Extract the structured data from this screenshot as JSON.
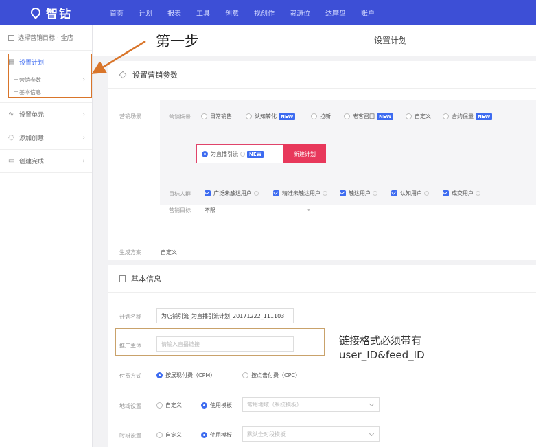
{
  "topbar": {
    "logo_text": "智钻",
    "nav": [
      "首页",
      "计划",
      "报表",
      "工具",
      "创意",
      "找创作",
      "资源位",
      "达摩盘",
      "账户"
    ]
  },
  "sidebar": {
    "target_label": "选择营销目标 · 全店",
    "items": [
      {
        "label": "设置计划",
        "active": true,
        "sub": [
          "营销参数",
          "基本信息"
        ]
      },
      {
        "label": "设置单元"
      },
      {
        "label": "添加创意"
      },
      {
        "label": "创建完成"
      }
    ]
  },
  "main": {
    "step_label": "第一步",
    "page_title": "设置计划"
  },
  "marketing": {
    "title": "设置营销参数",
    "section_label": "营销场景",
    "scene_label": "营销场景",
    "scenes": [
      {
        "label": "日常销售",
        "new": false,
        "selected": false
      },
      {
        "label": "认知转化",
        "new": true,
        "selected": false
      },
      {
        "label": "拉新",
        "new": false,
        "selected": false
      },
      {
        "label": "老客召回",
        "new": true,
        "selected": false
      },
      {
        "label": "自定义",
        "new": false,
        "selected": false
      },
      {
        "label": "合约保量",
        "new": true,
        "selected": false
      },
      {
        "label": "为直播引流",
        "new": true,
        "selected": true
      }
    ],
    "new_badge": "NEW",
    "plan_button": "新建计划",
    "audience_label": "目标人群",
    "audiences": [
      "广泛未触达用户",
      "精准未触达用户",
      "触达用户",
      "认知用户",
      "成交用户"
    ],
    "goal_label": "营销目标",
    "goal_value": "不限",
    "method_label": "生成方案",
    "method_value": "自定义"
  },
  "basic": {
    "title": "基本信息",
    "plan_name_label": "计划名称",
    "plan_name_value": "为店铺引流_为直播引流计划_20171222_111103",
    "promo_label": "推广主体",
    "promo_placeholder": "请输入直播链接",
    "bid_label": "付费方式",
    "bid_options": [
      {
        "label": "按展现付费（CPM）",
        "selected": true
      },
      {
        "label": "按点击付费（CPC）",
        "selected": false
      }
    ],
    "region_label": "地域设置",
    "region_custom": "自定义",
    "region_template": "使用模板",
    "region_select": "常用地域（系统模板）",
    "time_label": "时段设置",
    "time_custom": "自定义",
    "time_template": "使用模板",
    "time_select": "默认全时段模板"
  },
  "annotation": {
    "line1": "链接格式必须带有",
    "line2": "user_ID&feed_ID"
  },
  "colors": {
    "topbar": "#3d4fd6",
    "accent_blue": "#3d6bf0",
    "accent_red": "#e8385b",
    "annotation_orange": "#d9752a"
  }
}
